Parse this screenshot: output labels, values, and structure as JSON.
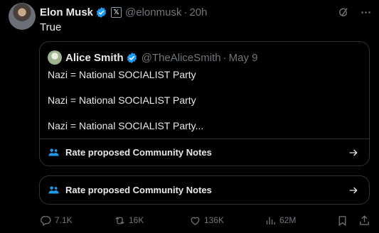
{
  "post": {
    "author_name": "Elon Musk",
    "author_handle": "@elonmusk",
    "separator": "·",
    "time": "20h",
    "x_badge": "𝕏",
    "text": "True"
  },
  "quote": {
    "author_name": "Alice Smith",
    "author_handle": "@TheAliceSmith",
    "separator": "·",
    "date": "May 9",
    "lines": [
      "Nazi = National SOCIALIST Party",
      "Nazi = National SOCIALIST Party",
      "Nazi = National SOCIALIST Party..."
    ],
    "community_notes_label": "Rate proposed Community Notes"
  },
  "community_notes": {
    "label": "Rate proposed Community Notes"
  },
  "metrics": {
    "replies": "7.1K",
    "reposts": "16K",
    "likes": "136K",
    "views": "62M"
  },
  "colors": {
    "background": "#000000",
    "text": "#e7e9ea",
    "muted": "#71767b",
    "verified": "#1d9bf0",
    "border": "#2f3336"
  },
  "icons": {
    "verified": "verified-badge-icon",
    "grok": "grok-icon",
    "more": "more-icon",
    "community_notes": "people-icon",
    "arrow": "arrow-right-icon",
    "reply": "reply-icon",
    "repost": "repost-icon",
    "like": "heart-icon",
    "views": "views-icon",
    "bookmark": "bookmark-icon",
    "share": "share-icon"
  }
}
